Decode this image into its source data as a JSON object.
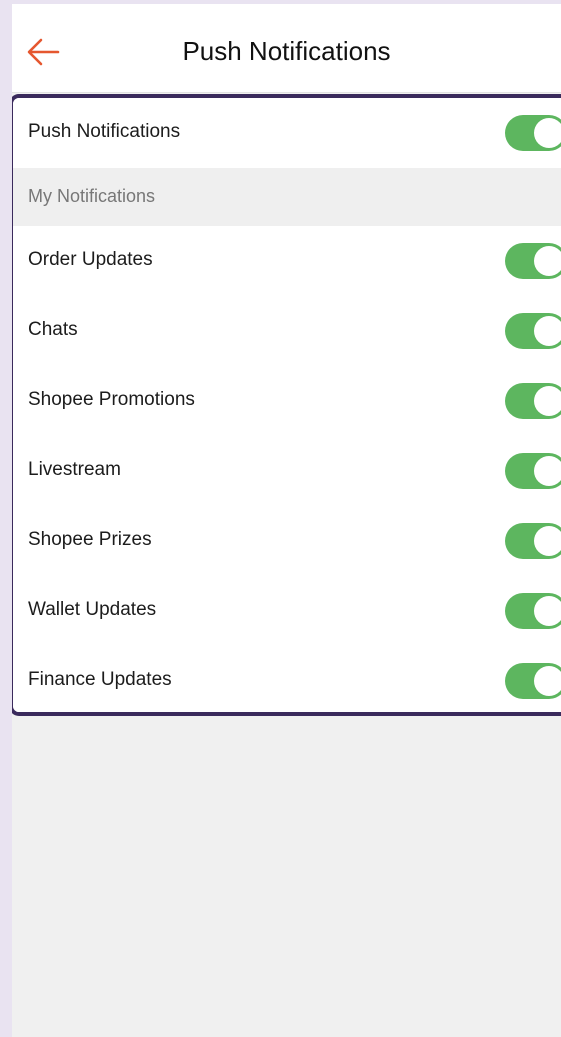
{
  "header": {
    "title": "Push Notifications",
    "back_icon": "back-arrow-icon",
    "accent_color": "#e5572f"
  },
  "master": {
    "label": "Push Notifications",
    "enabled": true
  },
  "section": {
    "label": "My Notifications"
  },
  "items": [
    {
      "label": "Order Updates",
      "enabled": true
    },
    {
      "label": "Chats",
      "enabled": true
    },
    {
      "label": "Shopee Promotions",
      "enabled": true
    },
    {
      "label": "Livestream",
      "enabled": true
    },
    {
      "label": "Shopee Prizes",
      "enabled": true
    },
    {
      "label": "Wallet Updates",
      "enabled": true
    },
    {
      "label": "Finance Updates",
      "enabled": true
    }
  ],
  "colors": {
    "toggle_on": "#5db65f",
    "highlight_border": "#3a2a5c"
  }
}
